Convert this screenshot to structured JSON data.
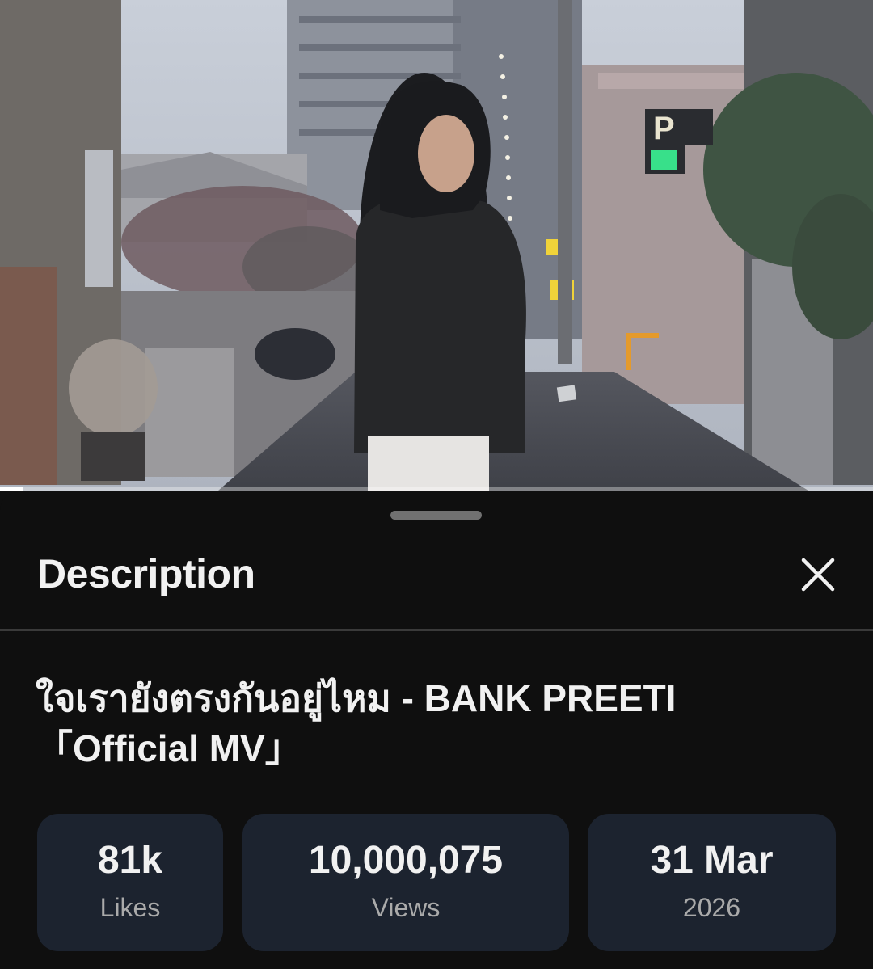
{
  "player": {
    "progress_fraction": 0.026,
    "colors": {
      "progress_fill": "#ffffff",
      "progress_track": "#8a8a8a"
    }
  },
  "description_sheet": {
    "title": "Description",
    "close_icon": "close-icon",
    "video_title": "ใจเรายังตรงกันอยู่ไหม - BANK PREETI 「Official MV」",
    "stats": [
      {
        "value": "81k",
        "label": "Likes"
      },
      {
        "value": "10,000,075",
        "label": "Views"
      },
      {
        "value": "31 Mar",
        "label": "2026"
      }
    ]
  },
  "colors": {
    "background": "#0f0f0f",
    "card_background": "#1c232f",
    "primary_text": "#f1f1f1",
    "secondary_text": "#aaaaaa"
  }
}
